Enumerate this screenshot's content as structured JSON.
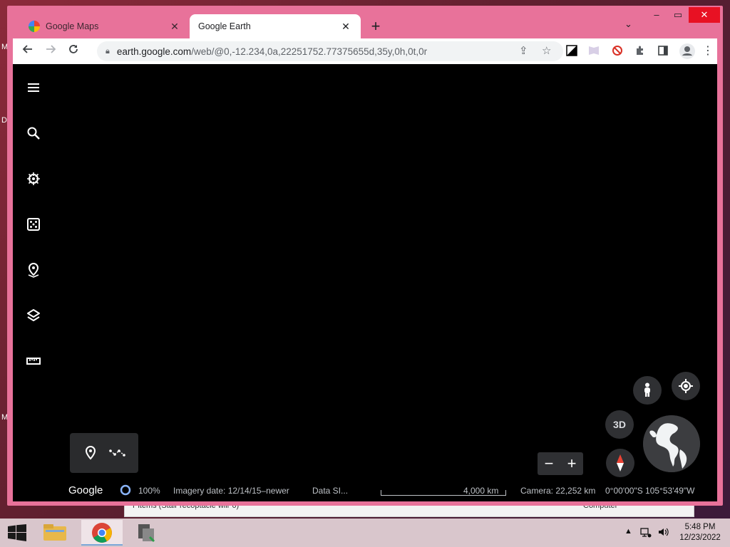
{
  "desktop": {
    "letters": [
      "M",
      "D",
      "M"
    ],
    "background_window_text": "Pitems (Stair recoptacle wiir 6)",
    "background_window_right": "Computer"
  },
  "browser": {
    "tabs": [
      {
        "title": "Google Maps",
        "favicon": "google-maps-icon",
        "active": false
      },
      {
        "title": "Google Earth",
        "favicon": "google-earth-icon",
        "active": true
      }
    ],
    "new_tab": "+",
    "url_host": "earth.google.com",
    "url_path": "/web/@0,-12.234,0a,22251752.77375655d,35y,0h,0t,0r"
  },
  "earth": {
    "sidebar_icons": [
      "menu-icon",
      "search-icon",
      "voyager-icon",
      "feeling-lucky-icon",
      "projects-icon",
      "map-style-icon",
      "measure-icon"
    ],
    "view_mode_label": "3D",
    "zoom_out": "−",
    "zoom_in": "+",
    "status": {
      "brand": "Google",
      "streaming": "100%",
      "imagery_date": "Imagery date: 12/14/15–newer",
      "data_source": "Data SI...",
      "scale": "4,000 km",
      "camera": "Camera: 22,252 km",
      "coordinates": "0°00'00\"S 105°53'49\"W"
    }
  },
  "taskbar": {
    "clock_time": "5:48 PM",
    "clock_date": "12/23/2022"
  },
  "colors": {
    "window_frame": "#e8729a",
    "earth_bg": "#000000",
    "compass_red": "#ea4335"
  }
}
